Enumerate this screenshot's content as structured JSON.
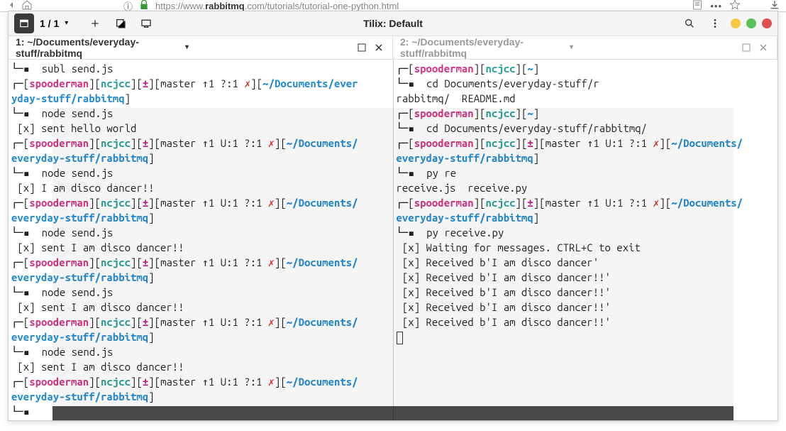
{
  "browser": {
    "url_proto": "https://www.",
    "url_domain": "rabbitmq",
    "url_rest": ".com/tutorials/tutorial-one-python.html"
  },
  "tilix": {
    "title": "Tilix: Default",
    "page_count": "1 / 1"
  },
  "tabs": [
    {
      "label": "1: ~/Documents/everyday-stuff/rabbitmq",
      "active": true
    },
    {
      "label": "2: ~/Documents/everyday-stuff/rabbitmq",
      "active": false
    }
  ],
  "prompt": {
    "user": "spooderman",
    "host": "ncjcc",
    "branch_char": "±",
    "branch_short": "master ↑1 ?:1",
    "branch_long": "master ↑1 U:1 ?:1",
    "x": "✗",
    "path": "~/Documents/everyday-stuff/rabbitmq",
    "path_wrap1": "~/Documents/ever",
    "path_wrap1b": "yday-stuff/rabbitmq",
    "path_wrap2": "~/Documents/",
    "path_wrap2b": "everyday-stuff/rabbitmq",
    "tilde": "~"
  },
  "left": {
    "l1": "└─▪  subl send.js",
    "l3": "└─▪  node send.js",
    "l4": " [x] sent hello world",
    "l6": "└─▪  node send.js",
    "l7": " [x] I am disco dancer!!",
    "l9": "└─▪  node send.js",
    "l10": " [x] sent I am disco dancer!!",
    "l12": "└─▪  node send.js",
    "l13": " [x] sent I am disco dancer!!",
    "l15": "└─▪  node send.js",
    "l16": " [x] sent I am disco dancer!!",
    "l18": "└─▪"
  },
  "right": {
    "l2": "└─▪  cd Documents/everyday-stuff/r",
    "l3": "rabbitmq/  README.md",
    "l5": "└─▪  cd Documents/everyday-stuff/rabbitmq/",
    "l7": "└─▪  py re",
    "l8": "receive.js  receive.py",
    "l10": "└─▪  py receive.py",
    "l11": " [x] Waiting for messages. CTRL+C to exit",
    "l12": " [x] Received b'I am disco dancer'",
    "l13": " [x] Received b'I am disco dancer!!'",
    "l14": " [x] Received b'I am disco dancer!!'",
    "l15": " [x] Received b'I am disco dancer!!'",
    "l16": " [x] Received b'I am disco dancer!!'"
  }
}
